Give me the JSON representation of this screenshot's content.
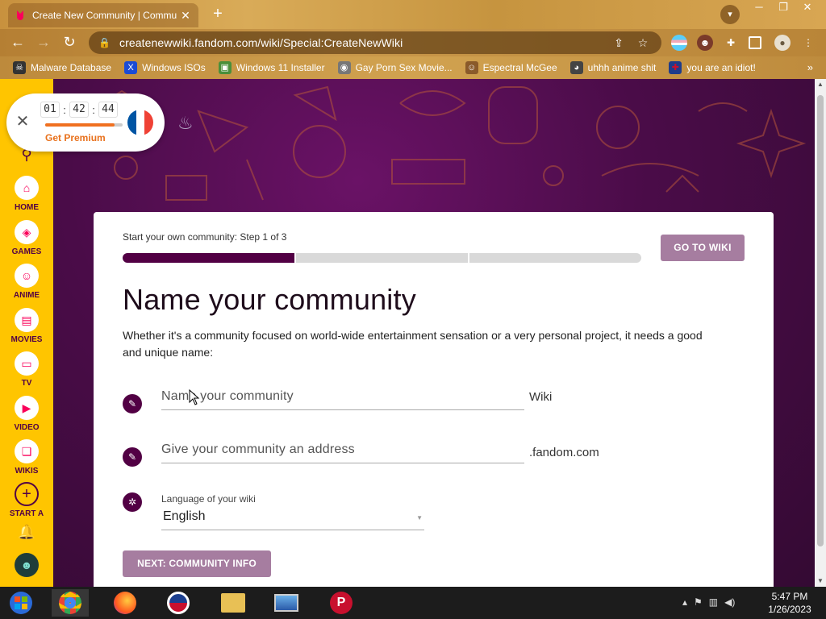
{
  "browser": {
    "tab_title": "Create New Community | Commu",
    "url": "createnewwiki.fandom.com/wiki/Special:CreateNewWiki",
    "bookmarks": [
      {
        "label": "Malware Database",
        "icon": "skull-icon",
        "color": "#333333"
      },
      {
        "label": "Windows ISOs",
        "icon": "x-icon",
        "color": "#1a4bd6"
      },
      {
        "label": "Windows 11 Installer",
        "icon": "installer-icon",
        "color": "#4a8f3a"
      },
      {
        "label": "Gay Porn Sex Movie...",
        "icon": "bookmark-icon",
        "color": "#777777"
      },
      {
        "label": "Espectral McGee",
        "icon": "avatar-icon",
        "color": "#8a5a2a"
      },
      {
        "label": "uhhh anime shit",
        "icon": "anime-icon",
        "color": "#444444"
      },
      {
        "label": "you are an idiot!",
        "icon": "flag-uk-icon",
        "color": "#c8102e"
      }
    ]
  },
  "sidebar": {
    "items": [
      {
        "label": "HOME",
        "icon": "home-icon"
      },
      {
        "label": "GAMES",
        "icon": "gamepad-icon"
      },
      {
        "label": "ANIME",
        "icon": "anime-face-icon"
      },
      {
        "label": "MOVIES",
        "icon": "clapper-icon"
      },
      {
        "label": "TV",
        "icon": "tv-icon"
      },
      {
        "label": "VIDEO",
        "icon": "play-icon"
      },
      {
        "label": "WIKIS",
        "icon": "book-icon"
      },
      {
        "label": "START A",
        "icon": "plus-icon"
      }
    ]
  },
  "vpn": {
    "hours": "01",
    "minutes": "42",
    "seconds": "44",
    "progress": 0.9,
    "premium_label": "Get Premium",
    "country": "France"
  },
  "card": {
    "step_text": "Start your own community: Step 1 of 3",
    "step_current": 1,
    "step_total": 3,
    "go_to_wiki": "GO TO WIKI",
    "heading": "Name your community",
    "description": "Whether it's a community focused on world-wide entertainment sensation or a very personal project, it needs a good and unique name:",
    "name_field": {
      "placeholder": "Name your community",
      "value": "",
      "suffix": "Wiki"
    },
    "address_field": {
      "placeholder": "Give your community an address",
      "value": "",
      "suffix": ".fandom.com"
    },
    "language_label": "Language of your wiki",
    "language_value": "English",
    "next_button": "NEXT: COMMUNITY INFO"
  },
  "colors": {
    "fandom_purple": "#520044",
    "fandom_yellow": "#ffc500",
    "button_disabled": "#a67da0"
  },
  "taskbar": {
    "time": "5:47 PM",
    "date": "1/26/2023"
  }
}
